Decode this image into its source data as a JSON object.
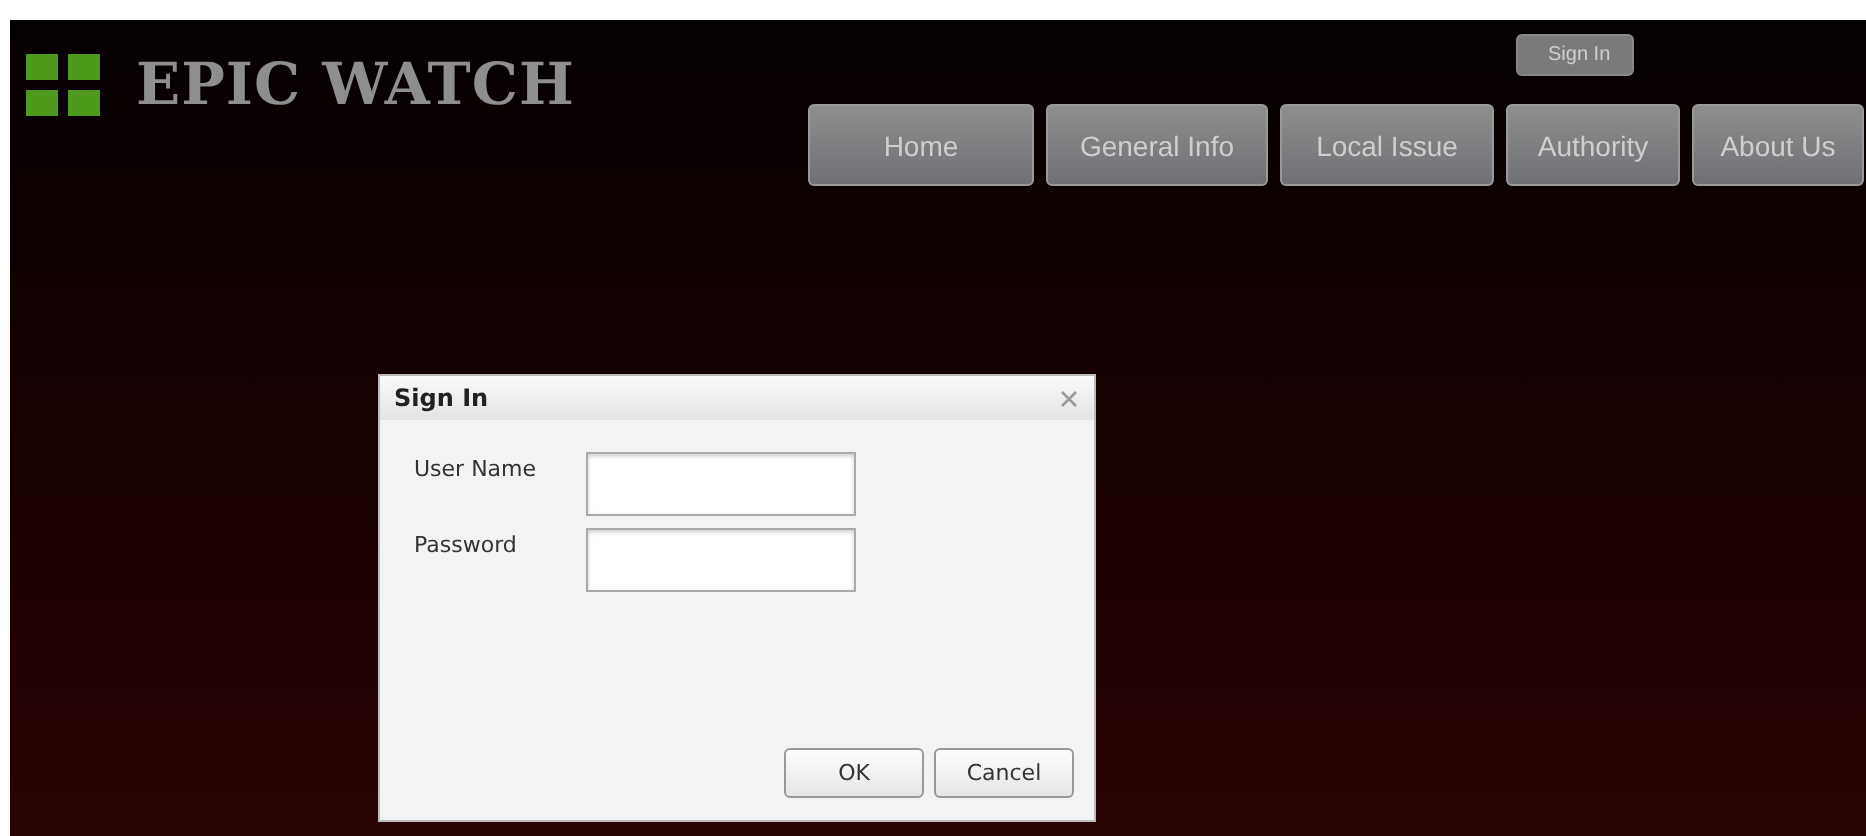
{
  "logo": {
    "title": "EPIC WATCH"
  },
  "sign_in_link": "Sign In",
  "nav": [
    {
      "label": "Home"
    },
    {
      "label": "General Info"
    },
    {
      "label": "Local Issue"
    },
    {
      "label": "Authority"
    },
    {
      "label": "About Us"
    }
  ],
  "dialog": {
    "title": "Sign In",
    "fields": [
      {
        "label": "User Name"
      },
      {
        "label": "Password"
      }
    ],
    "buttons": [
      "OK",
      "Cancel"
    ]
  }
}
